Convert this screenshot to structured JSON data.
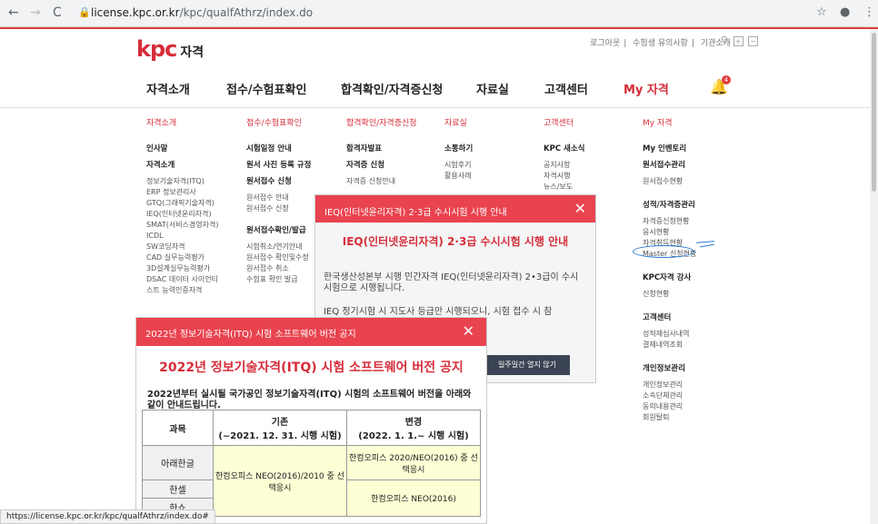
{
  "browser": {
    "url_host": "license.kpc.or.kr",
    "url_path": "/kpc/qualfAthrz/index.do",
    "status_url": "https://license.kpc.or.kr/kpc/qualfAthrz/index.do#"
  },
  "header": {
    "logo_mark": "kpc",
    "logo_text": "자격",
    "util_links": [
      "로그아웃",
      "수험생 유의사항",
      "기관소개"
    ],
    "notification_count": "4"
  },
  "gnb": [
    "자격소개",
    "접수/수험표확인",
    "합격확인/자격증신청",
    "자료실",
    "고객센터",
    "My 자격"
  ],
  "mega": {
    "col1": {
      "head": "자격소개",
      "items": [
        "인사말",
        "자격소개",
        "정보기술자격(ITQ)",
        "ERP 정보관리사",
        "GTQ(그래픽기술자격)",
        "IEQ(인터넷윤리자격)",
        "SMAT(서비스경영자격)",
        "ICDL",
        "SW코딩자격",
        "CAD 실무능력평가",
        "3D설계실무능력평가",
        "DSAC 데이터 사이언티",
        "스트 능력인증자격"
      ]
    },
    "col2": {
      "head": "접수/수험표확인",
      "items": [
        "시험일정 안내",
        "원서 사진 등록 규정",
        "원서접수 신청",
        "원서접수 안내",
        "원서접수 신청",
        "원서접수확인/발급",
        "시험취소/연기안내",
        "원서접수 확인및수정",
        "원서접수 취소",
        "수험표 확인 발급"
      ]
    },
    "col3": {
      "head": "합격확인/자격증신청",
      "items": [
        "합격자발표",
        "자격증 신청",
        "자격증 신청안내"
      ]
    },
    "col4": {
      "head": "자료실",
      "items": [
        "소통하기",
        "시험후기",
        "활용사례"
      ]
    },
    "col5": {
      "head": "고객센터",
      "items": [
        "KPC 새소식",
        "공지사항",
        "자격시행",
        "뉴스/보도"
      ]
    },
    "col6": {
      "head": "My 자격",
      "items": [
        "My 인벤토리",
        "원서접수관리",
        "원서접수현황",
        "성적/자격증관리",
        "자격증신청현황",
        "응시현황",
        "자격취득현황",
        "Master 신청현황",
        "KPC자격 강사",
        "신청현황",
        "고객센터",
        "성적재심사내역",
        "결제내역조회",
        "개인정보관리",
        "개인정보관리",
        "소속단체관리",
        "동의내용관리",
        "회원탈퇴"
      ]
    }
  },
  "popup_ieq": {
    "header": "IEQ(인터넷윤리자격) 2·3급 수시시험 시행 안내",
    "title": "IEQ(인터넷윤리자격) 2·3급 수시시험 시행 안내",
    "body1": "한국생산성본부 시행 민간자격 IEQ(인터넷윤리자격) 2•3급이 수시 시험으로 시행됩니다.",
    "body2": "IEQ 정기시험 시 지도사 등급만 시행되오니, 시험 접수 시 참",
    "close_week": "일주일간 열지 않기"
  },
  "popup_itq": {
    "header": "2022년 정보기술자격(ITQ) 시험 소프트웨어 버전 공지",
    "title": "2022년 정보기술자격(ITQ) 시험 소프트웨어 버전 공지",
    "intro": "2022년부터 실시될 국가공인 정보기술자격(ITQ) 시험의 소프트웨어 버전을 아래와 같이 안내드립니다.",
    "th_subject": "과목",
    "th_old": "기존",
    "th_old_sub": "(~2021. 12. 31. 시행 시험)",
    "th_new": "변경",
    "th_new_sub": "(2022. 1. 1.~ 시행 시험)",
    "rows": [
      {
        "subject": "아래한글",
        "new": "한컴오피스 2020/NEO(2016) 중 선택응시"
      },
      {
        "subject": "한셀",
        "new": "한컴오피스 NEO(2016)"
      },
      {
        "subject": "한쇼",
        "new": ""
      }
    ],
    "old_merged": "한컴오피스 NEO(2016)/2010 중 선택응시",
    "cutoff_row": "한컴오피스 NEO(2016)"
  }
}
